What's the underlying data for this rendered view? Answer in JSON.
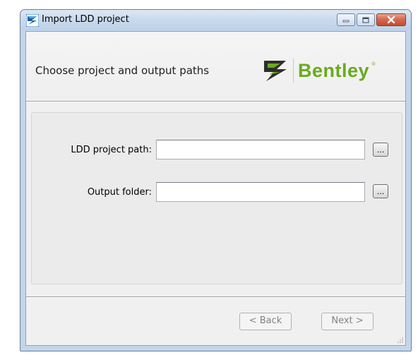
{
  "window": {
    "title": "Import LDD project",
    "icon": "bentley-app-icon",
    "caption_buttons": [
      "minimize-icon",
      "maximize-icon",
      "close-icon"
    ]
  },
  "header": {
    "title": "Choose project and output paths",
    "logo_text": "Bentley",
    "logo_reg": "®"
  },
  "form": {
    "project_path": {
      "label": "LDD project path:",
      "value": "",
      "browse_label": "..."
    },
    "output_folder": {
      "label": "Output folder:",
      "value": "",
      "browse_label": "..."
    }
  },
  "footer": {
    "back_label": "< Back",
    "next_label": "Next >"
  },
  "colors": {
    "brand_green": "#6aaa1e",
    "titlebar": "#c9daee",
    "close_button": "#c44d2f"
  }
}
